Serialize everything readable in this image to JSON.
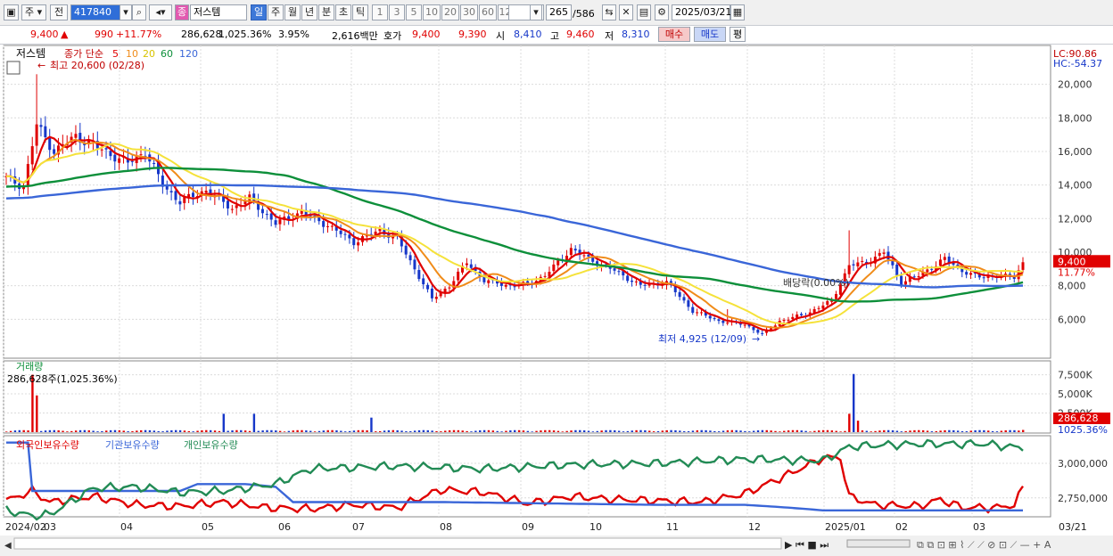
{
  "toolbar": {
    "type_label": "주",
    "scope_label": "전",
    "stock_code": "417840",
    "stock_name": "저스템",
    "stock_badge": "종",
    "periods": [
      "일",
      "주",
      "월",
      "년",
      "분",
      "초",
      "틱"
    ],
    "active_period": "일",
    "minute_steps": [
      "1",
      "3",
      "5",
      "10",
      "20",
      "30",
      "60",
      "120"
    ],
    "count_value": "265",
    "count_total": "/586",
    "date_value": "2025/03/21"
  },
  "quote": {
    "price": "9,400",
    "change": "990",
    "change_pct": "+11.77%",
    "volume": "286,628",
    "volume_ratio": "1,025.36%",
    "turnover": "3.95%",
    "amount": "2,616백만",
    "ask_label": "호가",
    "ask": "9,400",
    "bid": "9,390",
    "open_label": "시",
    "open": "8,410",
    "high_label": "고",
    "high": "9,460",
    "low_label": "저",
    "low": "8,310",
    "buy_label": "매수",
    "sell_label": "매도",
    "eval_label": "평"
  },
  "colors": {
    "up": "#e00000",
    "down": "#1637c9",
    "ma5": "#e00000",
    "ma10": "#f08c1a",
    "ma20": "#f5e23a",
    "ma60": "#0d8f3a",
    "ma120": "#3a66d8"
  },
  "chart_data": [
    {
      "type": "candlestick",
      "title": "저스템",
      "legend": {
        "prefix": "종가 단순",
        "series": [
          "5",
          "10",
          "20",
          "60",
          "120"
        ]
      },
      "y_ticks": [
        6000,
        8000,
        10000,
        12000,
        14000,
        16000,
        18000,
        20000
      ],
      "y_tick_labels": [
        "6,000",
        "8,000",
        "10,000",
        "12,000",
        "14,000",
        "16,000",
        "18,000",
        "20,000"
      ],
      "ylim": [
        4000,
        21200
      ],
      "x_labels": [
        "2024/02",
        "03",
        "04",
        "05",
        "06",
        "07",
        "08",
        "09",
        "10",
        "11",
        "12",
        "2025/01",
        "02",
        "03"
      ],
      "last_x_label": "03/21",
      "close_anchors": [
        [
          0,
          14400
        ],
        [
          4,
          13900
        ],
        [
          7,
          17600
        ],
        [
          11,
          16000
        ],
        [
          16,
          16900
        ],
        [
          22,
          16100
        ],
        [
          28,
          15300
        ],
        [
          32,
          16000
        ],
        [
          36,
          14000
        ],
        [
          40,
          13000
        ],
        [
          46,
          13700
        ],
        [
          52,
          12600
        ],
        [
          56,
          13200
        ],
        [
          62,
          11700
        ],
        [
          68,
          12400
        ],
        [
          74,
          11600
        ],
        [
          80,
          10600
        ],
        [
          86,
          11300
        ],
        [
          90,
          10800
        ],
        [
          94,
          9000
        ],
        [
          98,
          7200
        ],
        [
          102,
          8000
        ],
        [
          106,
          9400
        ],
        [
          110,
          8300
        ],
        [
          116,
          8000
        ],
        [
          120,
          8100
        ],
        [
          124,
          8600
        ],
        [
          130,
          10200
        ],
        [
          134,
          9600
        ],
        [
          140,
          8900
        ],
        [
          146,
          8000
        ],
        [
          152,
          8200
        ],
        [
          158,
          6500
        ],
        [
          164,
          5900
        ],
        [
          170,
          5700
        ],
        [
          174,
          5100
        ],
        [
          178,
          5900
        ],
        [
          184,
          6300
        ],
        [
          190,
          7100
        ],
        [
          194,
          9200
        ],
        [
          198,
          9400
        ],
        [
          202,
          10000
        ],
        [
          206,
          8200
        ],
        [
          210,
          8600
        ],
        [
          216,
          9600
        ],
        [
          220,
          8900
        ],
        [
          224,
          8500
        ],
        [
          228,
          8600
        ],
        [
          232,
          8500
        ],
        [
          234,
          9400
        ]
      ],
      "spikes": [
        {
          "i": 7,
          "high": 20600
        },
        {
          "i": 166,
          "high": 6600
        },
        {
          "i": 194,
          "high": 11300
        }
      ],
      "high_annotation": "최고 20,600 (02/28)",
      "low_annotation": "최저 4,925 (12/09)",
      "dividend_annotation": "배당락(0.00%)",
      "lc_label": "LC:90.86",
      "hc_label": "HC:-54.37",
      "last_price_label": "9,400",
      "last_change_label": "11.77%"
    },
    {
      "type": "bar",
      "title": "거래량",
      "subtitle": "286,628주(1,025.36%)",
      "y_tick_labels": [
        "2,500K",
        "5,000K",
        "7,500K"
      ],
      "y_ticks": [
        2500000,
        5000000,
        7500000
      ],
      "ylim": [
        0,
        8500000
      ],
      "base_volume": 120000,
      "spikes": [
        {
          "i": 6,
          "v": 7500000
        },
        {
          "i": 7,
          "v": 4800000
        },
        {
          "i": 50,
          "v": 2400000
        },
        {
          "i": 57,
          "v": 2400000
        },
        {
          "i": 84,
          "v": 1900000
        },
        {
          "i": 195,
          "v": 7600000
        },
        {
          "i": 194,
          "v": 2400000
        },
        {
          "i": 196,
          "v": 1500000
        }
      ],
      "last_volume_label": "286,628",
      "last_ratio_label": "1025.36%"
    },
    {
      "type": "line",
      "series": [
        {
          "name": "외국인보유수량",
          "color": "#e00000",
          "anchors": [
            [
              0,
              2730000
            ],
            [
              6,
              2800000
            ],
            [
              10,
              2720000
            ],
            [
              20,
              2760000
            ],
            [
              30,
              2700000
            ],
            [
              40,
              2690000
            ],
            [
              50,
              2720000
            ],
            [
              60,
              2680000
            ],
            [
              70,
              2670000
            ],
            [
              80,
              2700000
            ],
            [
              90,
              2680000
            ],
            [
              100,
              2810000
            ],
            [
              110,
              2790000
            ],
            [
              120,
              2710000
            ],
            [
              130,
              2760000
            ],
            [
              140,
              2740000
            ],
            [
              150,
              2730000
            ],
            [
              160,
              2720000
            ],
            [
              170,
              2780000
            ],
            [
              180,
              2920000
            ],
            [
              188,
              3040000
            ],
            [
              192,
              3040000
            ],
            [
              194,
              2760000
            ],
            [
              200,
              2700000
            ],
            [
              210,
              2690000
            ],
            [
              215,
              2740000
            ],
            [
              220,
              2680000
            ],
            [
              228,
              2680000
            ],
            [
              232,
              2700000
            ],
            [
              234,
              2820000
            ]
          ]
        },
        {
          "name": "기관보유수량",
          "color": "#3a66d8",
          "anchors": [
            [
              0,
              3150000
            ],
            [
              5,
              3150000
            ],
            [
              6,
              2800000
            ],
            [
              30,
              2800000
            ],
            [
              40,
              2800000
            ],
            [
              44,
              2850000
            ],
            [
              55,
              2850000
            ],
            [
              62,
              2830000
            ],
            [
              66,
              2720000
            ],
            [
              100,
              2720000
            ],
            [
              150,
              2700000
            ],
            [
              170,
              2700000
            ],
            [
              180,
              2680000
            ],
            [
              188,
              2660000
            ],
            [
              234,
              2660000
            ]
          ]
        },
        {
          "name": "개인보유수량",
          "color": "#228b55",
          "anchors": [
            [
              0,
              2660000
            ],
            [
              6,
              2620000
            ],
            [
              10,
              2630000
            ],
            [
              20,
              2820000
            ],
            [
              30,
              2830000
            ],
            [
              40,
              2790000
            ],
            [
              50,
              2800000
            ],
            [
              62,
              2850000
            ],
            [
              70,
              2960000
            ],
            [
              90,
              2980000
            ],
            [
              110,
              2960000
            ],
            [
              130,
              2990000
            ],
            [
              150,
              3000000
            ],
            [
              170,
              3030000
            ],
            [
              188,
              3020000
            ],
            [
              194,
              3120000
            ],
            [
              200,
              3130000
            ],
            [
              210,
              3140000
            ],
            [
              225,
              3140000
            ],
            [
              234,
              3110000
            ]
          ]
        }
      ],
      "y_tick_labels": [
        "2,750,000",
        "3,000,000"
      ],
      "y_ticks": [
        2750000,
        3000000
      ],
      "ylim": [
        2620000,
        3180000
      ]
    }
  ]
}
